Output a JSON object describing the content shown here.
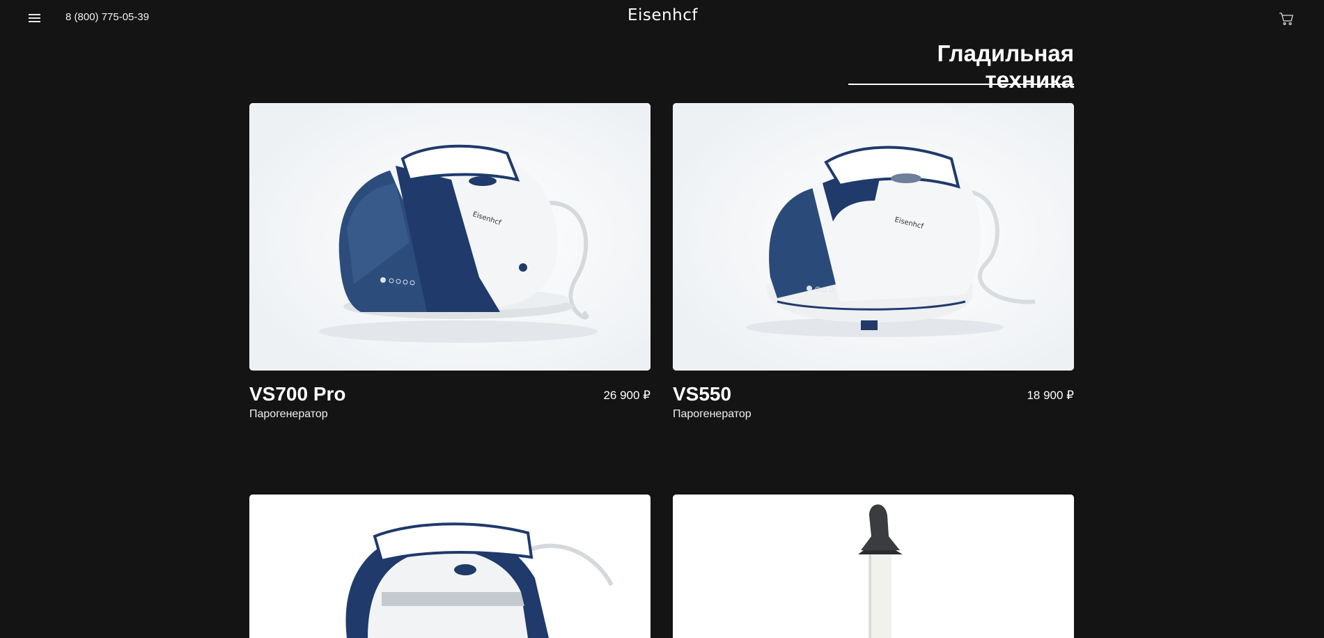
{
  "header": {
    "phone": "8 (800) 775-05-39",
    "logo": "Eisenhcf"
  },
  "section": {
    "title": "Гладильная техника"
  },
  "products": [
    {
      "name": "VS700 Pro",
      "type": "Парогенератор",
      "price": "26 900 ₽"
    },
    {
      "name": "VS550",
      "type": "Парогенератор",
      "price": "18 900 ₽"
    }
  ],
  "product_images": {
    "brand_mark": "Eisenhcf"
  },
  "colors": {
    "background": "#141414",
    "accent_navy": "#1f3a6b",
    "text": "#ffffff"
  },
  "icons": [
    "menu-icon",
    "cart-icon"
  ]
}
